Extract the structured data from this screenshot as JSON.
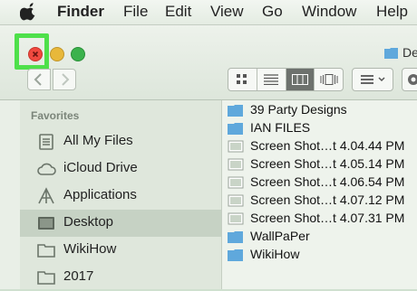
{
  "menubar": {
    "apple_icon": "apple-icon",
    "items": [
      {
        "label": "Finder",
        "bold": true
      },
      {
        "label": "File"
      },
      {
        "label": "Edit"
      },
      {
        "label": "View"
      },
      {
        "label": "Go"
      },
      {
        "label": "Window"
      },
      {
        "label": "Help"
      }
    ]
  },
  "window": {
    "title": "De",
    "accent_highlight": "#4ee04a"
  },
  "sidebar": {
    "heading": "Favorites",
    "items": [
      {
        "label": "All My Files",
        "icon": "all-files-icon"
      },
      {
        "label": "iCloud Drive",
        "icon": "cloud-icon"
      },
      {
        "label": "Applications",
        "icon": "applications-icon"
      },
      {
        "label": "Desktop",
        "icon": "desktop-icon",
        "selected": true
      },
      {
        "label": "WikiHow",
        "icon": "folder-icon"
      },
      {
        "label": "2017",
        "icon": "folder-icon"
      }
    ]
  },
  "files": [
    {
      "label": "39 Party Designs",
      "type": "folder"
    },
    {
      "label": "IAN FILES",
      "type": "folder"
    },
    {
      "label": "Screen Shot…t 4.04.44 PM",
      "type": "image"
    },
    {
      "label": "Screen Shot…t 4.05.14 PM",
      "type": "image"
    },
    {
      "label": "Screen Shot…t 4.06.54 PM",
      "type": "image"
    },
    {
      "label": "Screen Shot…t 4.07.12 PM",
      "type": "image"
    },
    {
      "label": "Screen Shot…t 4.07.31 PM",
      "type": "image"
    },
    {
      "label": "WallPaPer",
      "type": "folder"
    },
    {
      "label": "WikiHow",
      "type": "folder"
    }
  ]
}
